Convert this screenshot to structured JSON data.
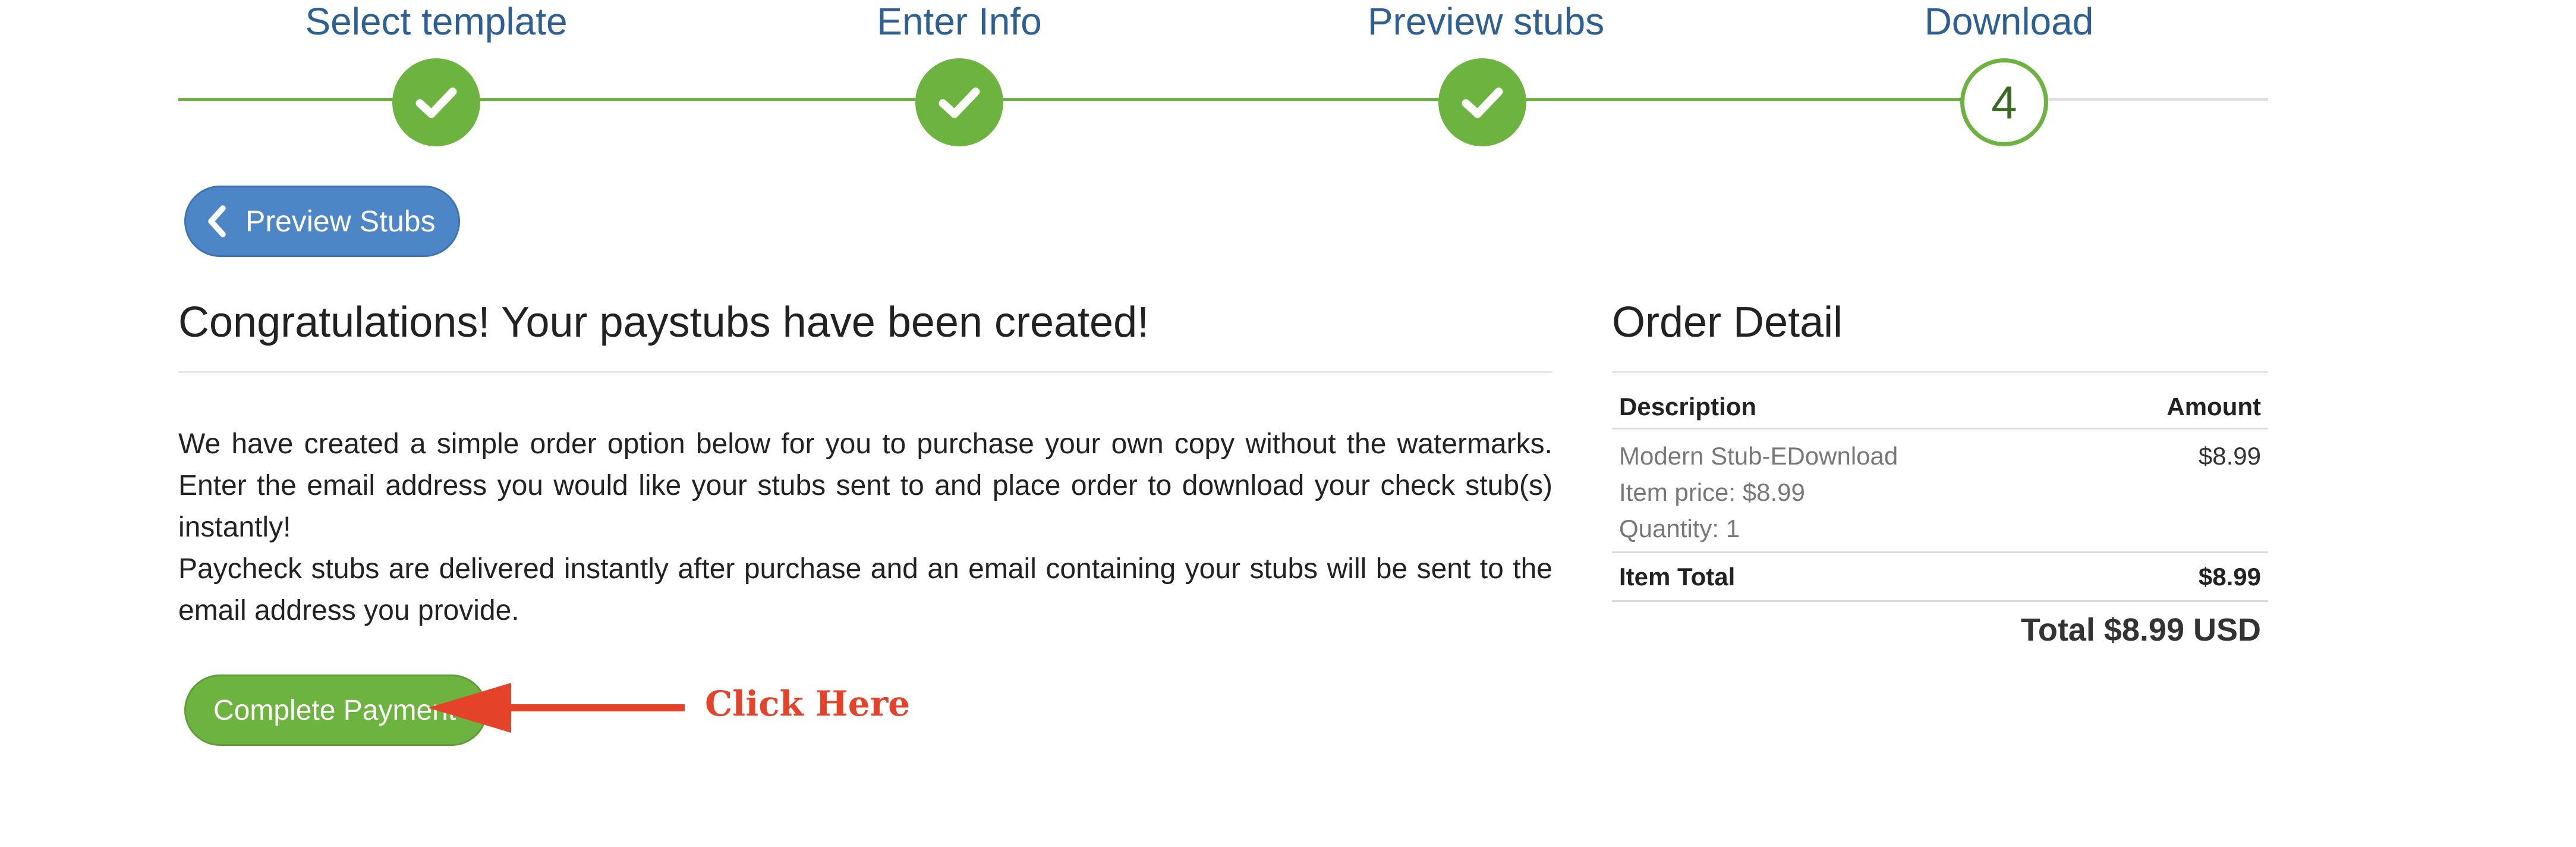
{
  "steps": [
    {
      "label": "Select template",
      "status": "done"
    },
    {
      "label": "Enter Info",
      "status": "done"
    },
    {
      "label": "Preview stubs",
      "status": "done"
    },
    {
      "label": "Download",
      "status": "current",
      "number": "4"
    }
  ],
  "back_button": {
    "label": "Preview Stubs"
  },
  "main": {
    "title": "Congratulations! Your paystubs have been created!",
    "paragraphs": [
      "We have created a simple order option below for you to purchase your own copy without the watermarks. Enter the email address you would like your stubs sent to and place order to download your check stub(s) instantly!",
      "Paycheck stubs are delivered instantly after purchase and an email containing your stubs will be sent to the email address you provide."
    ],
    "pay_button": "Complete Payment",
    "annotation": "Click Here"
  },
  "order": {
    "title": "Order Detail",
    "columns": {
      "description": "Description",
      "amount": "Amount"
    },
    "item": {
      "name": "Modern Stub-EDownload",
      "price_line": "Item price: $8.99",
      "quantity_line": "Quantity: 1",
      "amount": "$8.99"
    },
    "item_total": {
      "label": "Item Total",
      "amount": "$8.99"
    },
    "grand_total": "Total $8.99 USD"
  },
  "colors": {
    "accent_green": "#6cb33f",
    "button_blue": "#4d86c6",
    "step_label_blue": "#2d5f93",
    "annotation_red": "#e4432a"
  },
  "icons": {
    "done_step": "check-icon",
    "back": "chevron-left-icon",
    "annotation": "arrow-left-icon"
  }
}
